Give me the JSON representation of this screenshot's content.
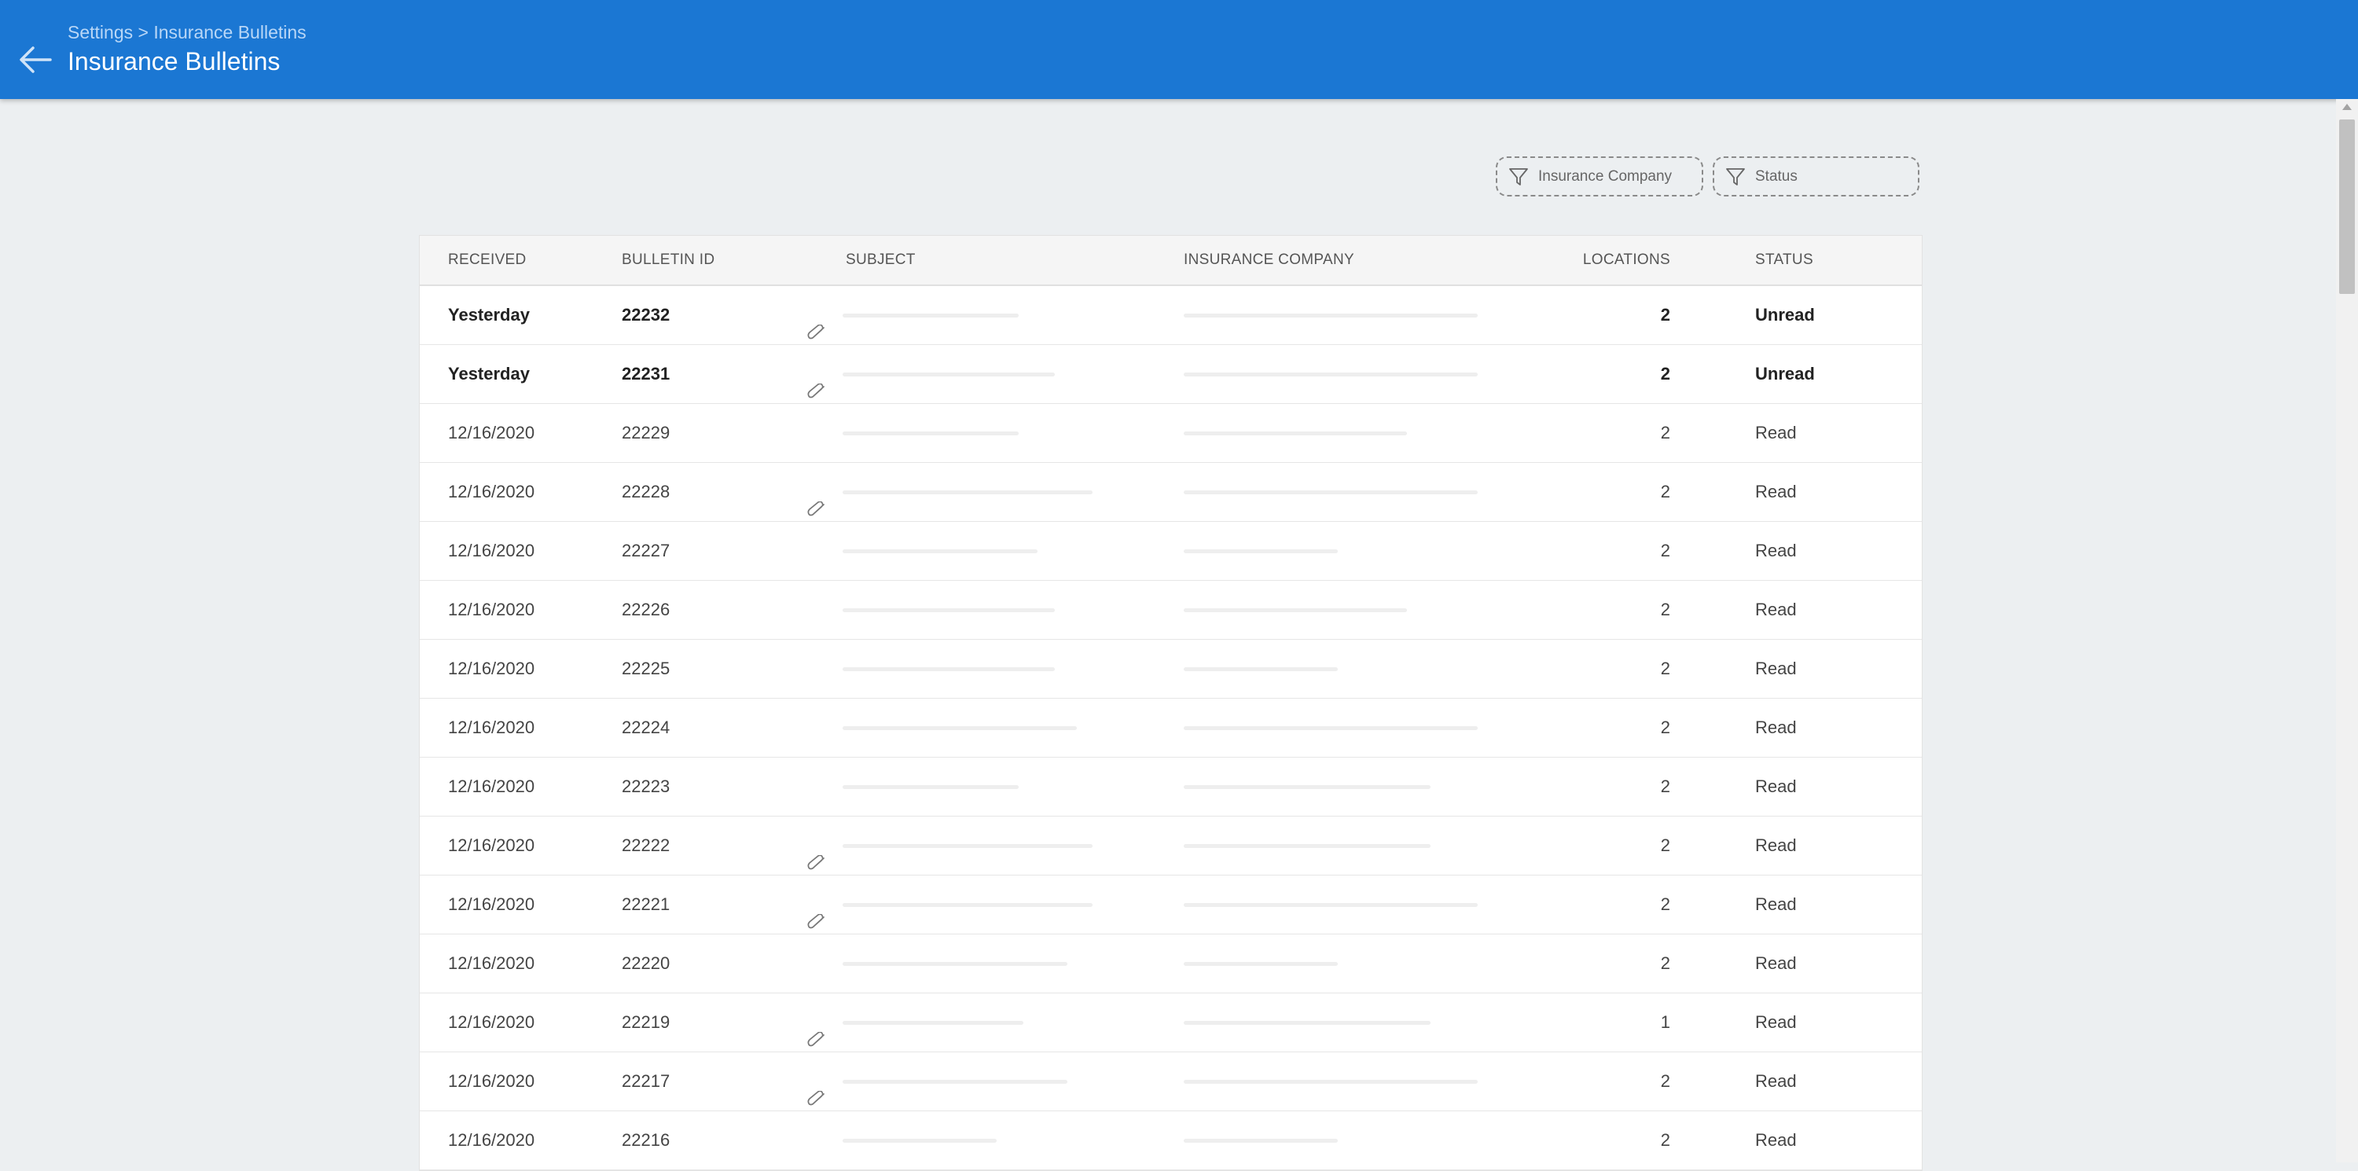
{
  "header": {
    "breadcrumb": "Settings > Insurance Bulletins",
    "title": "Insurance Bulletins",
    "back_icon": "arrow-left-icon",
    "background": "#1b77d3"
  },
  "filters": {
    "insurance_company_label": "Insurance Company",
    "status_label": "Status",
    "icon": "filter-funnel-icon"
  },
  "table": {
    "columns": [
      "RECEIVED",
      "BULLETIN ID",
      "SUBJECT",
      "INSURANCE COMPANY",
      "LOCATIONS",
      "STATUS"
    ],
    "rows": [
      {
        "received": "Yesterday",
        "id": "22232",
        "attachment": true,
        "locations": "2",
        "status": "Unread",
        "unread": true
      },
      {
        "received": "Yesterday",
        "id": "22231",
        "attachment": true,
        "locations": "2",
        "status": "Unread",
        "unread": true
      },
      {
        "received": "12/16/2020",
        "id": "22229",
        "attachment": false,
        "locations": "2",
        "status": "Read",
        "unread": false
      },
      {
        "received": "12/16/2020",
        "id": "22228",
        "attachment": true,
        "locations": "2",
        "status": "Read",
        "unread": false
      },
      {
        "received": "12/16/2020",
        "id": "22227",
        "attachment": false,
        "locations": "2",
        "status": "Read",
        "unread": false
      },
      {
        "received": "12/16/2020",
        "id": "22226",
        "attachment": false,
        "locations": "2",
        "status": "Read",
        "unread": false
      },
      {
        "received": "12/16/2020",
        "id": "22225",
        "attachment": false,
        "locations": "2",
        "status": "Read",
        "unread": false
      },
      {
        "received": "12/16/2020",
        "id": "22224",
        "attachment": false,
        "locations": "2",
        "status": "Read",
        "unread": false
      },
      {
        "received": "12/16/2020",
        "id": "22223",
        "attachment": false,
        "locations": "2",
        "status": "Read",
        "unread": false
      },
      {
        "received": "12/16/2020",
        "id": "22222",
        "attachment": true,
        "locations": "2",
        "status": "Read",
        "unread": false
      },
      {
        "received": "12/16/2020",
        "id": "22221",
        "attachment": true,
        "locations": "2",
        "status": "Read",
        "unread": false
      },
      {
        "received": "12/16/2020",
        "id": "22220",
        "attachment": false,
        "locations": "2",
        "status": "Read",
        "unread": false
      },
      {
        "received": "12/16/2020",
        "id": "22219",
        "attachment": true,
        "locations": "1",
        "status": "Read",
        "unread": false
      },
      {
        "received": "12/16/2020",
        "id": "22217",
        "attachment": true,
        "locations": "2",
        "status": "Read",
        "unread": false
      },
      {
        "received": "12/16/2020",
        "id": "22216",
        "attachment": false,
        "locations": "2",
        "status": "Read",
        "unread": false
      }
    ]
  }
}
